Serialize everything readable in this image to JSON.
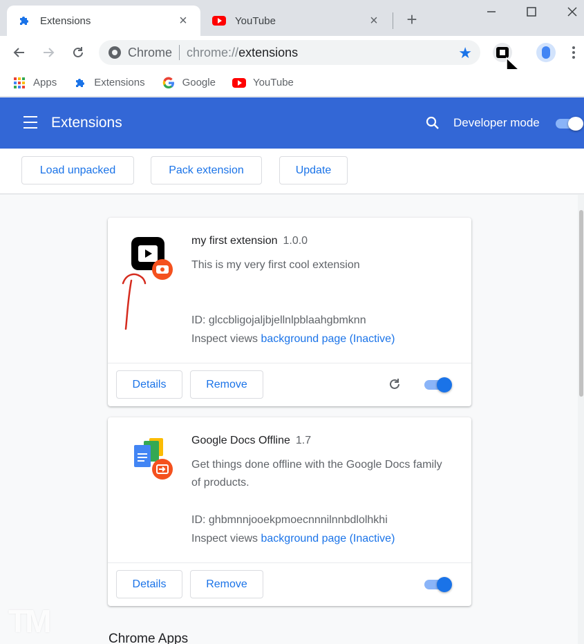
{
  "tabs": [
    {
      "title": "Extensions",
      "icon": "puzzle-icon",
      "active": true
    },
    {
      "title": "YouTube",
      "icon": "youtube-icon",
      "active": false
    }
  ],
  "toolbar": {
    "site_label": "Chrome",
    "url_scheme": "chrome://",
    "url_path": "extensions"
  },
  "bookmarks": [
    {
      "label": "Apps",
      "icon": "apps-grid-icon"
    },
    {
      "label": "Extensions",
      "icon": "puzzle-icon"
    },
    {
      "label": "Google",
      "icon": "google-icon"
    },
    {
      "label": "YouTube",
      "icon": "youtube-icon"
    }
  ],
  "header": {
    "title": "Extensions",
    "dev_mode_label": "Developer mode",
    "dev_mode_on": true
  },
  "dev_toolbar": {
    "load_unpacked": "Load unpacked",
    "pack_extension": "Pack extension",
    "update": "Update"
  },
  "extensions": [
    {
      "name": "my first extension",
      "version": "1.0.0",
      "description": "This is my very first cool extension",
      "id_text": "ID: glccbligojaljbjellnlpblaahgbmknn",
      "inspect_prefix": "Inspect views",
      "inspect_link": "background page (Inactive)",
      "details_label": "Details",
      "remove_label": "Remove",
      "enabled": true
    },
    {
      "name": "Google Docs Offline",
      "version": "1.7",
      "description": "Get things done offline with the Google Docs family of products.",
      "id_text": "ID: ghbmnnjooekpmoecnnnilnnbdlolhkhi",
      "inspect_prefix": "Inspect views",
      "inspect_link": "background page (Inactive)",
      "details_label": "Details",
      "remove_label": "Remove",
      "enabled": true
    }
  ],
  "section_title": "Chrome Apps",
  "watermark": "TM",
  "colors": {
    "header_blue": "#3367d6",
    "link_blue": "#1a73e8",
    "toggle_track": "#8ab4f8"
  }
}
